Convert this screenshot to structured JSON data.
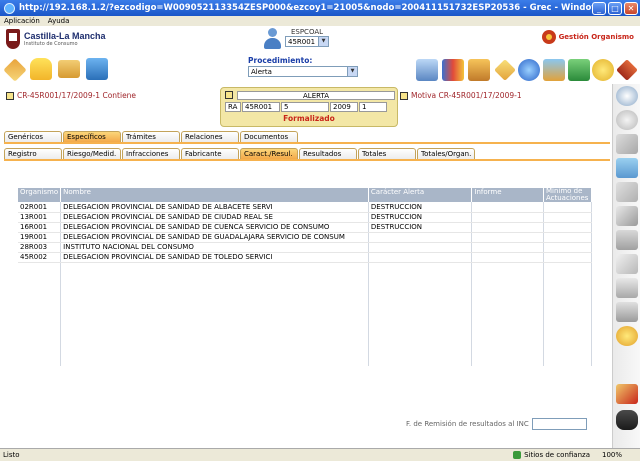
{
  "window": {
    "title": "http://192.168.1.2/?ezcodigo=W009052113354ZESP000&ezcoy1=21005&nodo=200411151732ESP20536 - Grec - Windows Internet Explorer"
  },
  "menu": [
    "Aplicación",
    "Ayuda"
  ],
  "header": {
    "brand": "Castilla-La Mancha",
    "brand_sub": "Instituto de Consumo",
    "espcoal_label": "ESPCOAL",
    "espcoal_value": "45R001",
    "gestion_label": "Gestión Organismo"
  },
  "procedimiento": {
    "label": "Procedimiento:",
    "value": "Alerta"
  },
  "records": {
    "left": "CR-45R001/17/2009-1 Contiene",
    "right": "Motiva CR-45R001/17/2009-1"
  },
  "alerta": {
    "title": "ALERTA",
    "cells": [
      "RA",
      "45R001",
      "5",
      "2009",
      "1"
    ],
    "status": "Formalizado"
  },
  "tabs_top": [
    {
      "label": "Genéricos",
      "active": false
    },
    {
      "label": "Específicos",
      "active": true
    },
    {
      "label": "Trámites",
      "active": false
    },
    {
      "label": "Relaciones",
      "active": false
    },
    {
      "label": "Documentos",
      "active": false
    }
  ],
  "tabs_sub": [
    {
      "label": "Registro",
      "active": false
    },
    {
      "label": "Riesgo/Medid.",
      "active": false
    },
    {
      "label": "Infracciones",
      "active": false
    },
    {
      "label": "Fabricante",
      "active": false
    },
    {
      "label": "Caract./Resul.",
      "active": true
    },
    {
      "label": "Resultados",
      "active": false
    },
    {
      "label": "Totales",
      "active": false
    },
    {
      "label": "Totales/Organ.",
      "active": false
    }
  ],
  "table": {
    "columns": [
      "Organismo",
      "Nombre",
      "Carácter Alerta",
      "Informe",
      "Mínimo de Actuaciones"
    ],
    "rows": [
      [
        "02R001",
        "DELEGACION PROVINCIAL DE SANIDAD DE ALBACETE SERVI",
        "DESTRUCCION",
        "",
        ""
      ],
      [
        "13R001",
        "DELEGACION PROVINCIAL DE SANIDAD DE CIUDAD REAL SE",
        "DESTRUCCION",
        "",
        ""
      ],
      [
        "16R001",
        "DELEGACION PROVINCIAL DE SANIDAD DE CUENCA SERVICIO DE CONSUMO",
        "DESTRUCCION",
        "",
        ""
      ],
      [
        "19R001",
        "DELEGACION PROVINCIAL DE SANIDAD DE GUADALAJARA SERVICIO DE CONSUM",
        "",
        "",
        ""
      ],
      [
        "28R003",
        "INSTITUTO NACIONAL DEL CONSUMO",
        "",
        "",
        ""
      ],
      [
        "45R002",
        "DELEGACION PROVINCIAL DE SANIDAD DE TOLEDO SERVICI",
        "",
        "",
        ""
      ]
    ]
  },
  "remision_label": "F. de Remisión de resultados al INC",
  "status": {
    "text": "Listo",
    "trust": "Sitios de confianza",
    "zoom": "100%"
  },
  "colors": {
    "accent_tab": "#f3a94a",
    "record_text": "#a0262b",
    "header_row": "#a9b6c8"
  }
}
